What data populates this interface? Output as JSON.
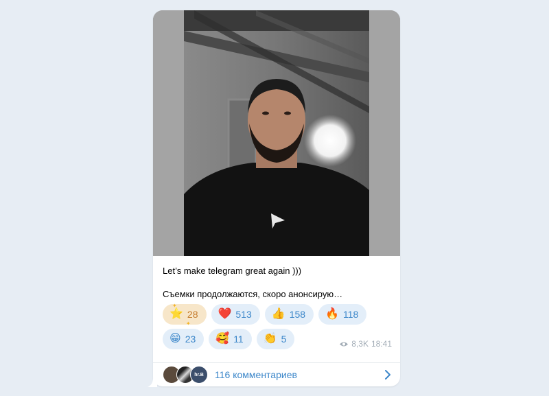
{
  "post": {
    "caption_line1": "Let’s make telegram great again )))",
    "caption_line2": "Съемки продолжаются, скоро анонсирую…"
  },
  "reactions": [
    {
      "emoji": "⭐",
      "icon": "star-icon",
      "count": "28",
      "selected": true
    },
    {
      "emoji": "❤️",
      "icon": "heart-icon",
      "count": "513"
    },
    {
      "emoji": "👍",
      "icon": "thumbs-up-icon",
      "count": "158"
    },
    {
      "emoji": "🔥",
      "icon": "fire-icon",
      "count": "118"
    },
    {
      "emoji": "😁",
      "icon": "grin-icon",
      "count": "23"
    },
    {
      "emoji": "🥰",
      "icon": "smiling-hearts-icon",
      "count": "11"
    },
    {
      "emoji": "👏",
      "icon": "clap-icon",
      "count": "5"
    }
  ],
  "meta": {
    "views": "8,3K",
    "time": "18:41"
  },
  "comments": {
    "label": "116 комментариев",
    "avatar3_text": "hr.B"
  },
  "colors": {
    "accent": "#3b86c9",
    "chip_bg": "#e3eef9",
    "star_bg": "#f7e6c9",
    "page_bg": "#e7edf4"
  }
}
